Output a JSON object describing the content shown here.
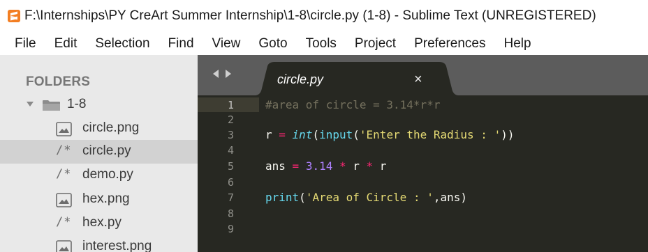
{
  "window": {
    "title": "F:\\Internships\\PY CreArt Summer Internship\\1-8\\circle.py (1-8) - Sublime Text (UNREGISTERED)"
  },
  "menu": [
    "File",
    "Edit",
    "Selection",
    "Find",
    "View",
    "Goto",
    "Tools",
    "Project",
    "Preferences",
    "Help"
  ],
  "sidebar": {
    "header": "FOLDERS",
    "folder": {
      "name": "1-8",
      "expanded": true
    },
    "files": [
      {
        "name": "circle.png",
        "icon": "image-file-icon",
        "selected": false
      },
      {
        "name": "circle.py",
        "icon": "code-file-icon",
        "selected": true
      },
      {
        "name": "demo.py",
        "icon": "code-file-icon",
        "selected": false
      },
      {
        "name": "hex.png",
        "icon": "image-file-icon",
        "selected": false
      },
      {
        "name": "hex.py",
        "icon": "code-file-icon",
        "selected": false
      },
      {
        "name": "interest.png",
        "icon": "image-file-icon",
        "selected": false
      }
    ],
    "code_icon_glyph": "/*"
  },
  "tabs": [
    {
      "label": "circle.py",
      "active": true,
      "close_glyph": "×"
    }
  ],
  "editor": {
    "current_line": 1,
    "lines": [
      {
        "num": "1",
        "tokens": [
          {
            "t": "#area of circle = 3.14*r*r",
            "c": "comment"
          }
        ]
      },
      {
        "num": "2",
        "tokens": []
      },
      {
        "num": "3",
        "tokens": [
          {
            "t": "r ",
            "c": "plain"
          },
          {
            "t": "=",
            "c": "op"
          },
          {
            "t": " ",
            "c": "plain"
          },
          {
            "t": "int",
            "c": "builtin"
          },
          {
            "t": "(",
            "c": "plain"
          },
          {
            "t": "input",
            "c": "func"
          },
          {
            "t": "(",
            "c": "plain"
          },
          {
            "t": "'Enter the Radius : '",
            "c": "str"
          },
          {
            "t": "))",
            "c": "plain"
          }
        ]
      },
      {
        "num": "4",
        "tokens": []
      },
      {
        "num": "5",
        "tokens": [
          {
            "t": "ans ",
            "c": "plain"
          },
          {
            "t": "=",
            "c": "op"
          },
          {
            "t": " ",
            "c": "plain"
          },
          {
            "t": "3.14",
            "c": "num"
          },
          {
            "t": " ",
            "c": "plain"
          },
          {
            "t": "*",
            "c": "op"
          },
          {
            "t": " r ",
            "c": "plain"
          },
          {
            "t": "*",
            "c": "op"
          },
          {
            "t": " r",
            "c": "plain"
          }
        ]
      },
      {
        "num": "6",
        "tokens": []
      },
      {
        "num": "7",
        "tokens": [
          {
            "t": "print",
            "c": "func"
          },
          {
            "t": "(",
            "c": "plain"
          },
          {
            "t": "'Area of Circle : '",
            "c": "str"
          },
          {
            "t": ",ans)",
            "c": "plain"
          }
        ]
      },
      {
        "num": "8",
        "tokens": []
      },
      {
        "num": "9",
        "tokens": []
      }
    ]
  },
  "colors": {
    "app_icon": "#f37e22",
    "sidebar_bg": "#e9e9e9",
    "sidebar_selected": "#d2d2d2",
    "editor_bg": "#272822",
    "tabbar_bg": "#5c5c5c",
    "active_tab_bg": "#272822"
  }
}
